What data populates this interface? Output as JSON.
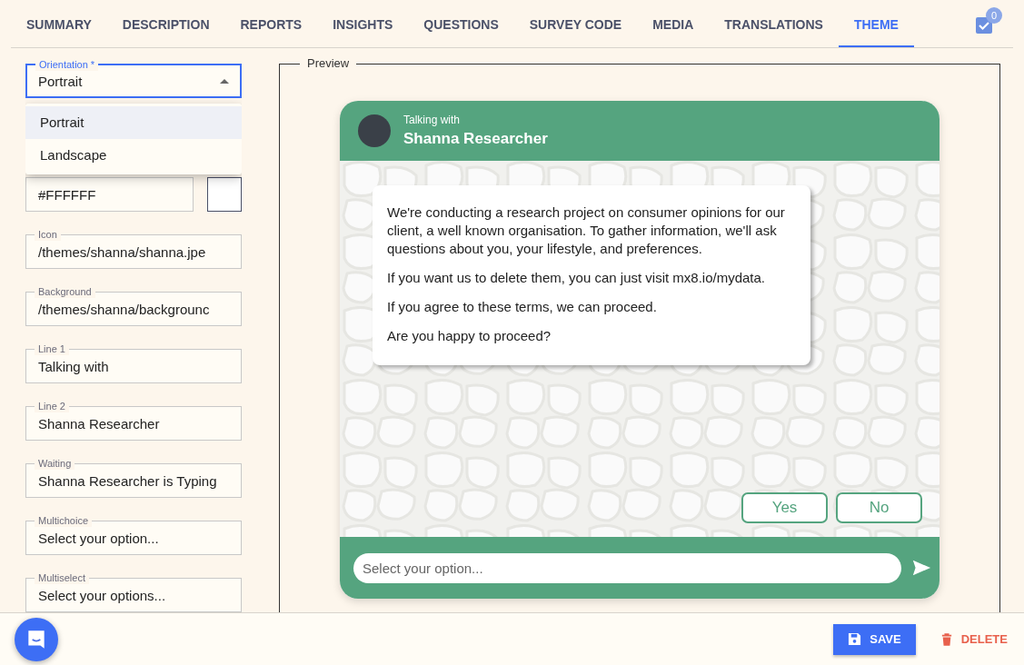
{
  "tabs": [
    {
      "label": "SUMMARY",
      "selected": false
    },
    {
      "label": "DESCRIPTION",
      "selected": false
    },
    {
      "label": "REPORTS",
      "selected": false
    },
    {
      "label": "INSIGHTS",
      "selected": false
    },
    {
      "label": "QUESTIONS",
      "selected": false
    },
    {
      "label": "SURVEY CODE",
      "selected": false
    },
    {
      "label": "MEDIA",
      "selected": false
    },
    {
      "label": "TRANSLATIONS",
      "selected": false
    },
    {
      "label": "THEME",
      "selected": true
    }
  ],
  "task_badge": {
    "count": "0"
  },
  "orientation_select": {
    "label": "Orientation *",
    "value": "Portrait",
    "expanded": true,
    "options": [
      {
        "label": "Portrait",
        "selected": true
      },
      {
        "label": "Landscape",
        "selected": false
      }
    ]
  },
  "secondary_field": {
    "value": "#FFFFFF"
  },
  "fields": [
    {
      "label": "Icon",
      "value": "/themes/shanna/shanna.jpe"
    },
    {
      "label": "Background",
      "value": "/themes/shanna/backgrounc"
    },
    {
      "label": "Line 1",
      "value": "Talking with"
    },
    {
      "label": "Line 2",
      "value": "Shanna Researcher"
    },
    {
      "label": "Waiting",
      "value": "Shanna Researcher is Typing"
    },
    {
      "label": "Multichoice",
      "value": "Select your option..."
    },
    {
      "label": "Multiselect",
      "value": "Select your options..."
    }
  ],
  "preview": {
    "legend": "Preview",
    "line1": "Talking with",
    "line2": "Shanna Researcher",
    "message": [
      "We're conducting a research project on consumer opinions for our client, a well known organisation. To gather information, we'll ask questions about you, your lifestyle, and preferences.",
      "If you want us to delete them, you can just visit mx8.io/mydata.",
      "If you agree to these terms, we can proceed.",
      "Are you happy to proceed?"
    ],
    "options": [
      "Yes",
      "No"
    ],
    "input_placeholder": "Select your option..."
  },
  "footer": {
    "save": "SAVE",
    "delete": "DELETE"
  }
}
